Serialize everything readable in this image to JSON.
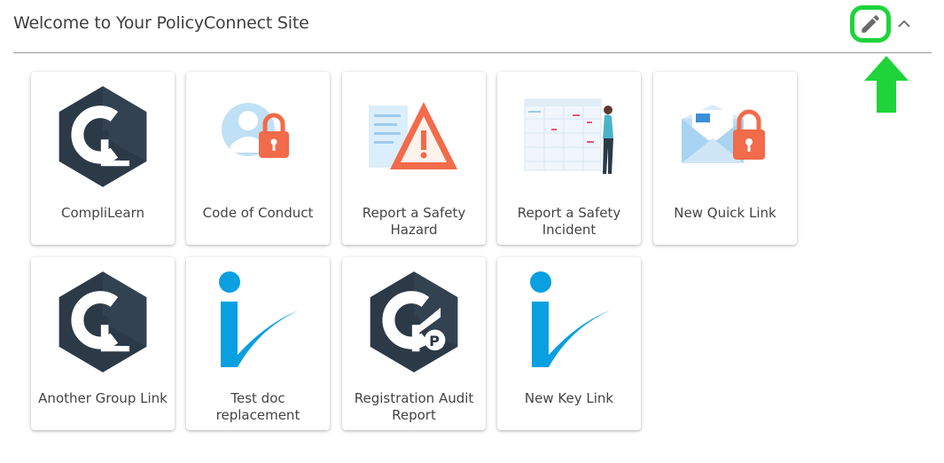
{
  "header": {
    "title": "Welcome to Your PolicyConnect Site",
    "edit_icon": "pencil-icon",
    "collapse_icon": "chevron-up-icon",
    "highlight_color": "#1fd43a",
    "arrow_color": "#1fd43a"
  },
  "tiles": [
    {
      "label": "CompliLearn",
      "icon": "complilearn-logo-icon"
    },
    {
      "label": "Code of Conduct",
      "icon": "user-lock-icon"
    },
    {
      "label": "Report a Safety Hazard",
      "icon": "warning-hazard-icon"
    },
    {
      "label": "Report a Safety Incident",
      "icon": "incident-report-icon"
    },
    {
      "label": "New Quick Link",
      "icon": "envelope-lock-icon"
    },
    {
      "label": "Another Group Link",
      "icon": "complilearn-logo-icon"
    },
    {
      "label": "Test doc replacement",
      "icon": "policyconnect-tick-icon"
    },
    {
      "label": "Registration Audit Report",
      "icon": "compliprep-logo-icon"
    },
    {
      "label": "New Key Link",
      "icon": "policyconnect-tick-icon"
    }
  ],
  "colors": {
    "hex_dark": "#2c3a48",
    "brand_blue": "#0a9fe0",
    "accent_orange": "#f26b4a",
    "light_blue": "#bfe0f5"
  }
}
